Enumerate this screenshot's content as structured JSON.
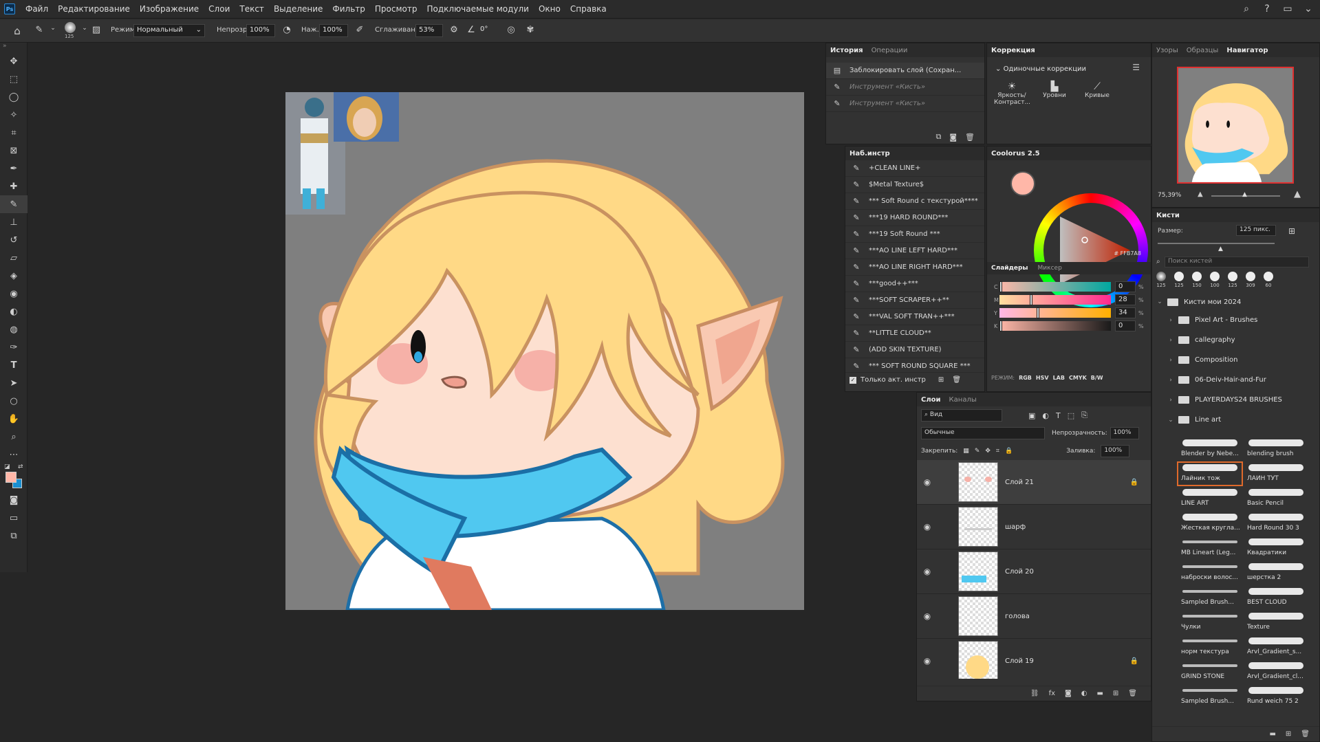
{
  "app": {
    "logo": "Ps"
  },
  "menu": [
    "Файл",
    "Редактирование",
    "Изображение",
    "Слои",
    "Текст",
    "Выделение",
    "Фильтр",
    "Просмотр",
    "Подключаемые модули",
    "Окно",
    "Справка"
  ],
  "options": {
    "brush_size": "125",
    "mode_label": "Режим:",
    "mode_value": "Нормальный",
    "opacity_label": "Непрозр.:",
    "opacity_value": "100%",
    "pressure_label": "Наж.:",
    "pressure_value": "100%",
    "smoothing_label": "Сглаживание:",
    "smoothing_value": "53%",
    "angle_value": "0°"
  },
  "history": {
    "tabs": [
      "История",
      "Операции"
    ],
    "items": [
      {
        "label": "Заблокировать слой (Сохран...",
        "dim": false
      },
      {
        "label": "Инструмент «Кисть»",
        "dim": true
      },
      {
        "label": "Инструмент «Кисть»",
        "dim": true
      }
    ]
  },
  "presets": {
    "title": "Наб.инстр",
    "items": [
      "+CLEAN  LINE+",
      "$Metal Texture$",
      "*** Soft Round с текстурой****",
      "***19 HARD ROUND***",
      "***19 Soft Round ***",
      "***AO LINE LEFT HARD***",
      "***AO LINE RIGHT HARD***",
      "***good++***",
      "***SOFT SCRAPER++**",
      "***VAL SOFT TRAN++***",
      "**LITTLE CLOUD**",
      "(ADD SKIN TEXTURE)",
      "*** SOFT ROUND SQUARE ***"
    ],
    "only_current": "Только акт. инстр"
  },
  "correction": {
    "title": "Коррекция",
    "section": "Одиночные коррекции",
    "items": [
      "Яркость/Контраст...",
      "Уровни",
      "Кривые"
    ]
  },
  "coolorus": {
    "title": "Coolorus 2.5",
    "hex": "# FFB7A8",
    "current_color": "#FFB7A8",
    "tabs": [
      "Слайдеры",
      "Миксер"
    ],
    "sliders": [
      {
        "label": "C",
        "value": "0",
        "fraction": 0
      },
      {
        "label": "M",
        "value": "28",
        "fraction": 0.28
      },
      {
        "label": "Y",
        "value": "34",
        "fraction": 0.34
      },
      {
        "label": "K",
        "value": "0",
        "fraction": 0
      }
    ],
    "modes_label": "РЕЖИМ:",
    "modes": [
      "RGB",
      "HSV",
      "LAB",
      "CMYK",
      "B/W"
    ]
  },
  "layers": {
    "tabs": [
      "Слои",
      "Каналы"
    ],
    "filter": "Вид",
    "blend": "Обычные",
    "opacity_label": "Непрозрачность:",
    "opacity": "100%",
    "lock_label": "Закрепить:",
    "fill_label": "Заливка:",
    "fill": "100%",
    "items": [
      {
        "name": "Слой 21",
        "locked": true,
        "selected": true
      },
      {
        "name": "шарф",
        "locked": false,
        "selected": false
      },
      {
        "name": "Слой 20",
        "locked": false,
        "selected": false
      },
      {
        "name": "голова",
        "locked": false,
        "selected": false
      },
      {
        "name": "Слой 19",
        "locked": true,
        "selected": false
      }
    ]
  },
  "navigator": {
    "tabs": [
      "Узоры",
      "Образцы",
      "Навигатор"
    ],
    "zoom": "75,39%"
  },
  "brushes": {
    "title": "Кисти",
    "size_label": "Размер:",
    "size_value": "125 пикс.",
    "search_placeholder": "Поиск кистей",
    "recent_sizes": [
      "125",
      "125",
      "150",
      "100",
      "125",
      "309",
      "60"
    ],
    "folders": [
      "Кисти мои 2024",
      "Pixel Art - Brushes",
      "callegraphy",
      "Composition",
      "06-Deiv-Hair-and-Fur",
      "PLAYERDAYS24 BRUSHES",
      "Line art"
    ],
    "items": [
      "Blender by Nebe...",
      "blending brush",
      "Лайник тож",
      "ЛАЙН ТУТ",
      "LINE ART",
      "Basic Pencil",
      "Жесткая кругла...",
      "Hard Round 30 3",
      "MB Lineart (Leg...",
      "Квадратики",
      "наброски волос...",
      "шерстка 2",
      "Sampled Brush...",
      "BEST CLOUD",
      "Чулки",
      "Texture",
      "норм текстура",
      "Arvl_Gradient_s...",
      "GRIND STONE",
      "Arvl_Gradient_cl...",
      "Sampled Brush...",
      "Rund weich 75 2"
    ]
  }
}
